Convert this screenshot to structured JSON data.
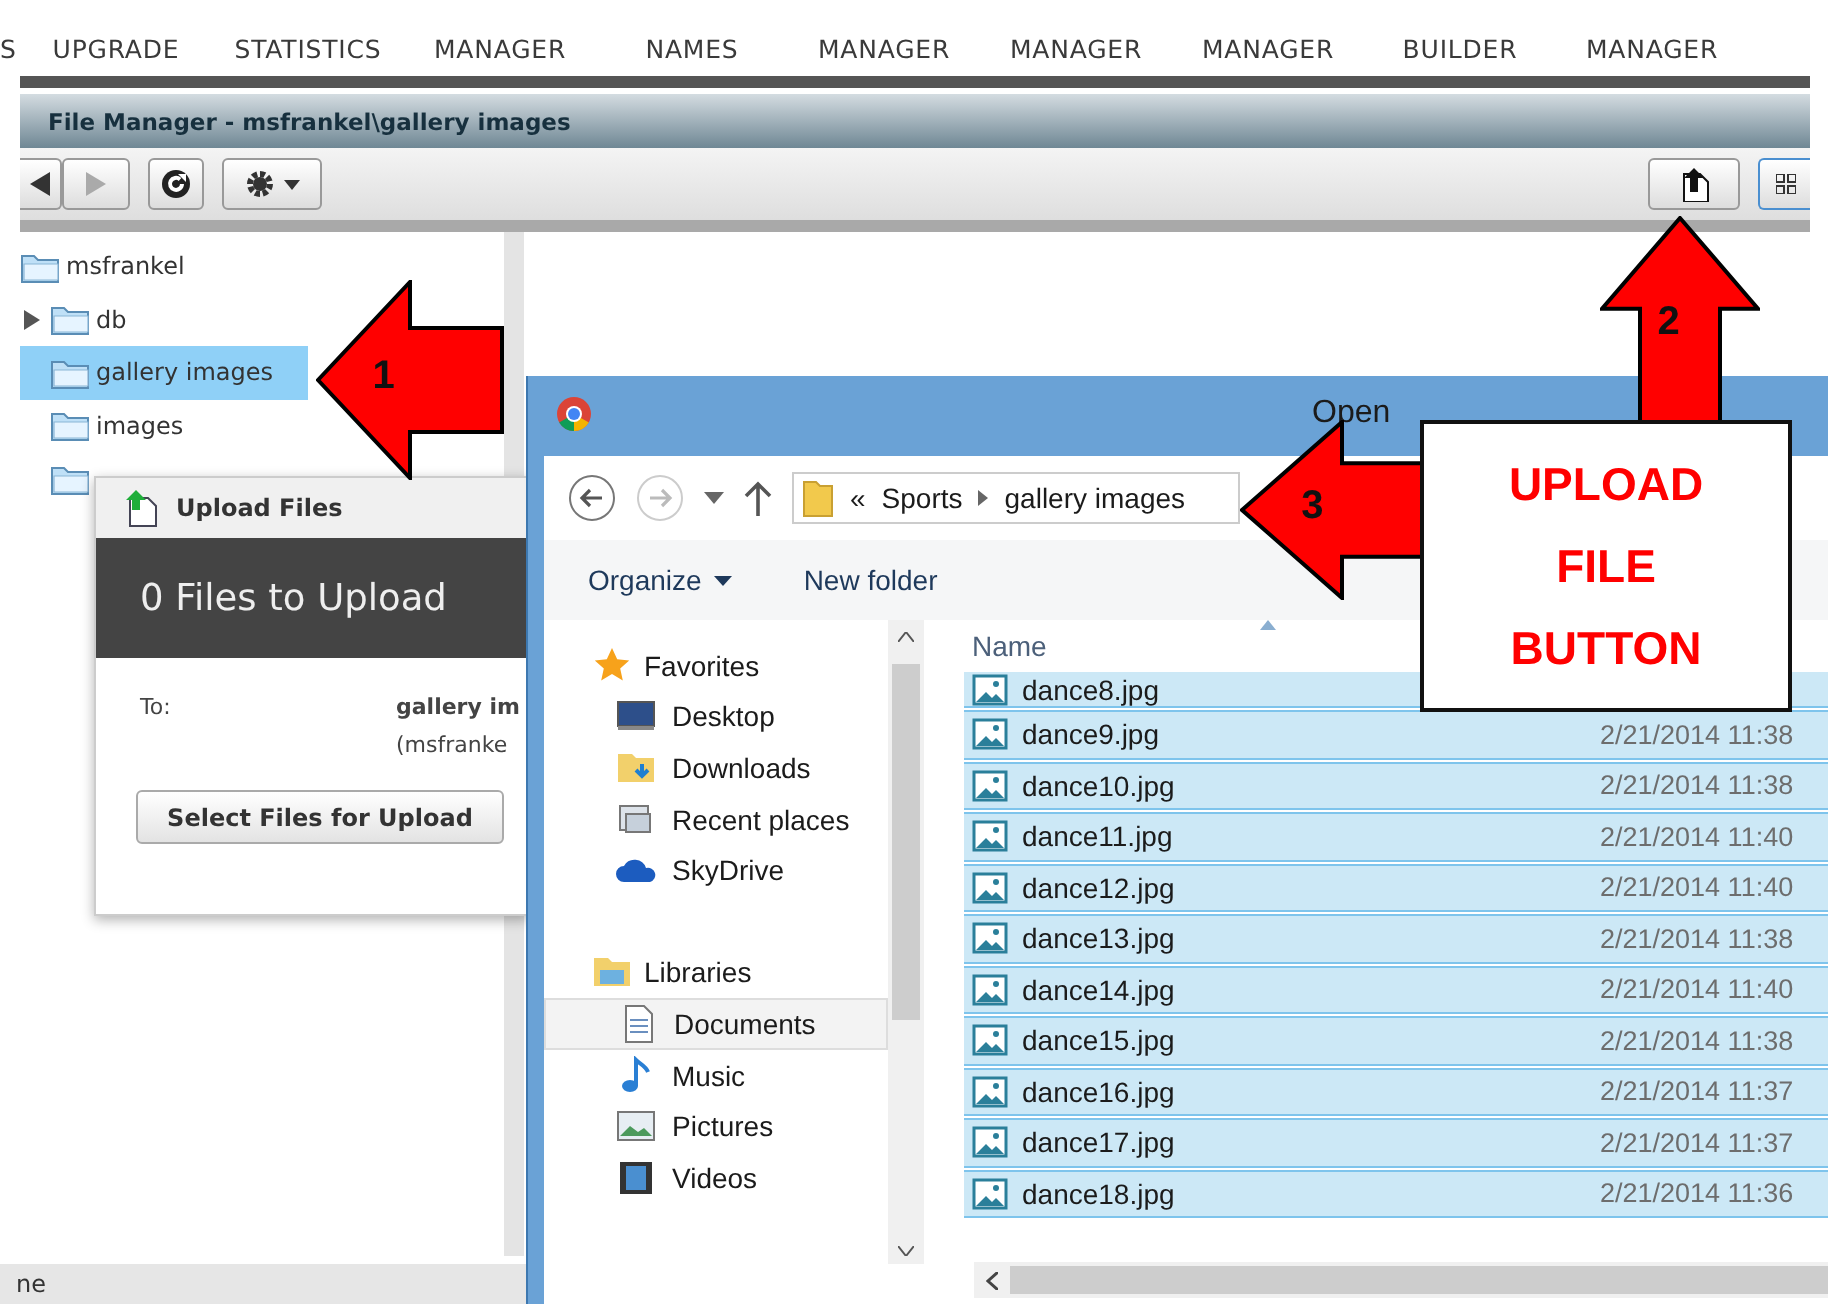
{
  "top_nav": [
    {
      "label": "S"
    },
    {
      "label": "UPGRADE"
    },
    {
      "label": "STATISTICS"
    },
    {
      "label": "MANAGER"
    },
    {
      "label": "NAMES"
    },
    {
      "label": "MANAGER"
    },
    {
      "label": "MANAGER"
    },
    {
      "label": "MANAGER"
    },
    {
      "label": "BUILDER"
    },
    {
      "label": "MANAGER"
    }
  ],
  "file_manager": {
    "title": "File Manager - msfrankel\\gallery images",
    "tree": [
      {
        "label": "msfrankel",
        "selected": false,
        "expandable": false,
        "children": [
          {
            "label": "db",
            "selected": false,
            "expandable": true
          },
          {
            "label": "gallery images",
            "selected": true,
            "expandable": false
          },
          {
            "label": "images",
            "selected": false,
            "expandable": false
          },
          {
            "selected": false,
            "expandable": false
          }
        ]
      }
    ],
    "status": "ne"
  },
  "upload_dialog": {
    "title": "Upload Files",
    "heading": "0 Files to Upload",
    "to_label": "To:",
    "destination": "gallery im",
    "destination_path": "(msfranke",
    "button": "Select Files for Upload"
  },
  "open_dialog": {
    "title": "Open",
    "address": {
      "overflow": "«",
      "path": [
        "Sports",
        "gallery images"
      ]
    },
    "commands": [
      {
        "label": "Organize",
        "kind": "menu"
      },
      {
        "label": "New folder",
        "kind": "button"
      }
    ],
    "nav_groups": [
      {
        "label": "Favorites",
        "kind": "favorites",
        "items": [
          {
            "label": "Desktop",
            "kind": "desktop",
            "hovered": false
          },
          {
            "label": "Downloads",
            "kind": "downloads",
            "hovered": false
          },
          {
            "label": "Recent places",
            "kind": "recent",
            "hovered": false
          },
          {
            "label": "SkyDrive",
            "kind": "cloud",
            "hovered": false
          }
        ]
      },
      {
        "label": "Libraries",
        "kind": "libraries",
        "items": [
          {
            "label": "Documents",
            "kind": "documents",
            "hovered": true
          },
          {
            "label": "Music",
            "kind": "music",
            "hovered": false
          },
          {
            "label": "Pictures",
            "kind": "pictures",
            "hovered": false
          },
          {
            "label": "Videos",
            "kind": "videos",
            "hovered": false
          }
        ]
      }
    ],
    "columns": [
      {
        "label": "Name",
        "sorted": true
      }
    ],
    "files": [
      {
        "name": "dance8.jpg",
        "selected": true
      },
      {
        "name": "dance9.jpg",
        "date": "2/21/2014 11:38",
        "selected": true
      },
      {
        "name": "dance10.jpg",
        "date": "2/21/2014 11:38",
        "selected": true
      },
      {
        "name": "dance11.jpg",
        "date": "2/21/2014 11:40",
        "selected": true
      },
      {
        "name": "dance12.jpg",
        "date": "2/21/2014 11:40",
        "selected": true
      },
      {
        "name": "dance13.jpg",
        "date": "2/21/2014 11:38",
        "selected": true
      },
      {
        "name": "dance14.jpg",
        "date": "2/21/2014 11:40",
        "selected": true
      },
      {
        "name": "dance15.jpg",
        "date": "2/21/2014 11:38",
        "selected": true
      },
      {
        "name": "dance16.jpg",
        "date": "2/21/2014 11:37",
        "selected": true
      },
      {
        "name": "dance17.jpg",
        "date": "2/21/2014 11:37",
        "selected": true
      },
      {
        "name": "dance18.jpg",
        "date": "2/21/2014 11:36",
        "selected": true
      }
    ]
  },
  "annotations": [
    {
      "kind": "arrow_left",
      "label": "1"
    },
    {
      "kind": "arrow_up",
      "label": "2"
    },
    {
      "kind": "arrow_left",
      "label": "3"
    }
  ],
  "callout": {
    "lines": [
      "UPLOAD",
      "FILE",
      "BUTTON"
    ]
  }
}
